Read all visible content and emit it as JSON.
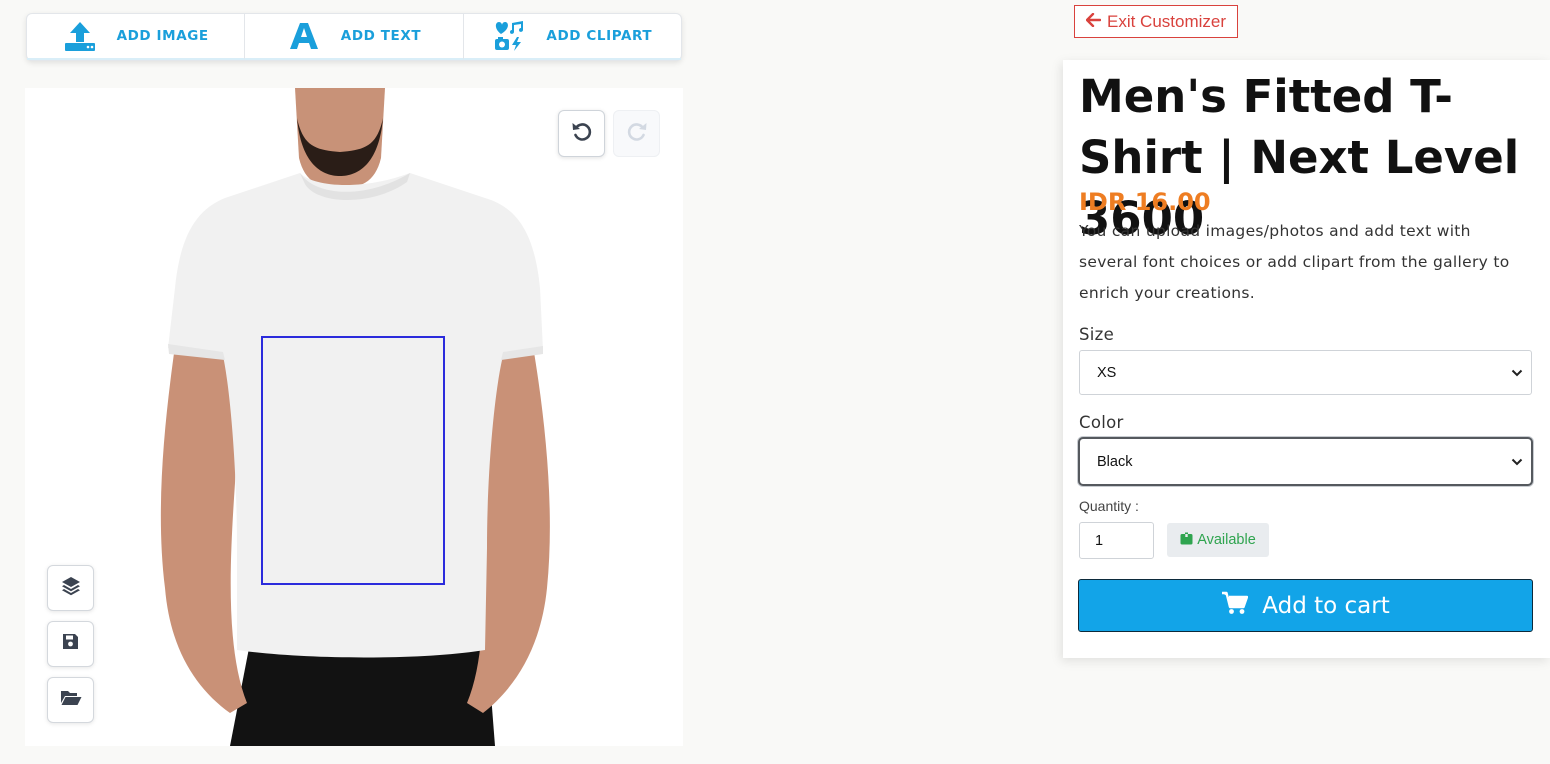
{
  "toolbar": {
    "add_image": {
      "label": "ADD IMAGE",
      "icon": "upload-icon"
    },
    "add_text": {
      "label": "ADD TEXT",
      "icon": "letter-a-icon"
    },
    "add_clipart": {
      "label": "ADD CLIPART",
      "icon": "clipart-icon"
    }
  },
  "canvas": {
    "product_image": "white t-shirt on male model",
    "undo_icon": "undo-icon",
    "redo_icon": "redo-icon",
    "side_tools": [
      "layers-icon",
      "save-icon",
      "folder-open-icon"
    ]
  },
  "exit": {
    "label": "Exit Customizer",
    "icon": "arrow-left-icon"
  },
  "product": {
    "title": "Men's Fitted T-Shirt | Next Level 3600",
    "price": "IDR 16.00",
    "description": "You can upload images/photos and add text with several font choices or add clipart from the gallery to enrich your creations."
  },
  "size": {
    "label": "Size",
    "value": "XS"
  },
  "color": {
    "label": "Color",
    "value": "Black"
  },
  "quantity": {
    "label": "Quantity :",
    "value": "1"
  },
  "availability": {
    "label": "Available",
    "icon": "box-icon"
  },
  "cart": {
    "label": "Add to cart",
    "icon": "cart-icon"
  },
  "colors": {
    "accent": "#1a9fdb",
    "cart_button": "#12a4e8",
    "price": "#ee7d22",
    "exit": "#d9423d",
    "available": "#2fa44f",
    "print_area": "#2b2bdc"
  }
}
